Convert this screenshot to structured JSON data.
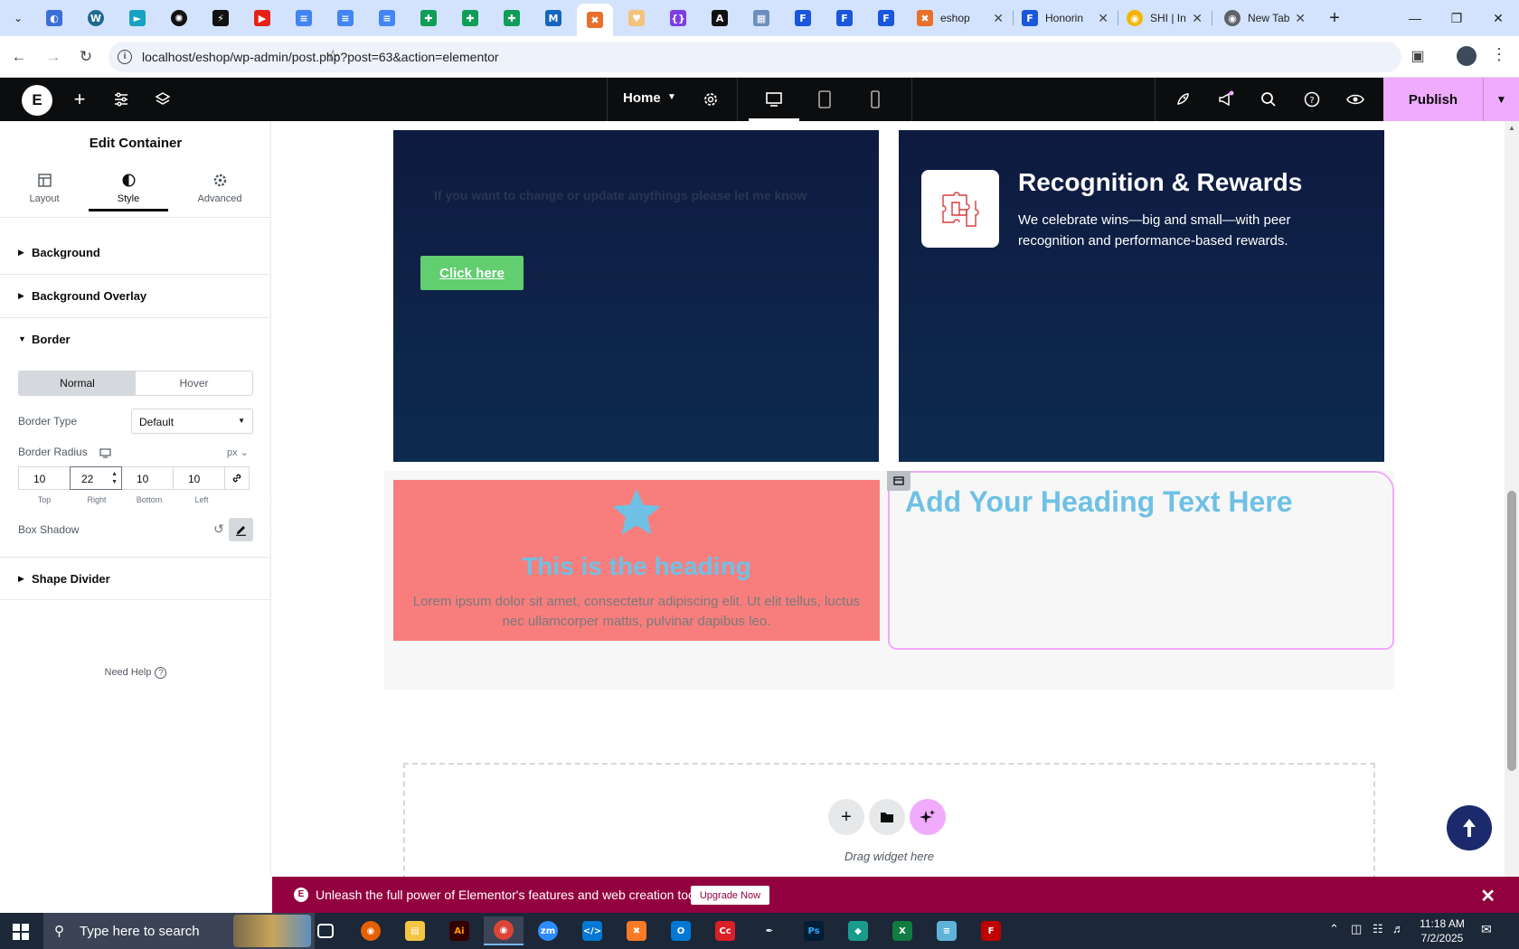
{
  "browser": {
    "tabs": [
      {
        "title": "eshop"
      },
      {
        "title": "Honorin"
      },
      {
        "title": "SHI | Inf"
      },
      {
        "title": "New Tab"
      }
    ],
    "url": "localhost/eshop/wp-admin/post.php?post=63&action=elementor"
  },
  "elementor": {
    "page_name": "Home",
    "publish_label": "Publish"
  },
  "panel": {
    "title": "Edit Container",
    "tabs": [
      {
        "label": "Layout"
      },
      {
        "label": "Style"
      },
      {
        "label": "Advanced"
      }
    ],
    "sections": {
      "background": "Background",
      "background_overlay": "Background Overlay",
      "border": "Border",
      "shape_divider": "Shape Divider"
    },
    "border": {
      "state_normal": "Normal",
      "state_hover": "Hover",
      "type_label": "Border Type",
      "type_value": "Default",
      "radius_label": "Border Radius",
      "unit": "px",
      "radius": {
        "top": "10",
        "right": "22",
        "bottom": "10",
        "left": "10"
      },
      "labels": {
        "top": "Top",
        "right": "Right",
        "bottom": "Bottom",
        "left": "Left"
      },
      "shadow_label": "Box Shadow"
    },
    "need_help": "Need Help"
  },
  "canvas": {
    "faded_text": "If you want to change or update anythings please let me know",
    "click_button": "Click here",
    "recognition_title": "Recognition & Rewards",
    "recognition_text": "We celebrate wins—big and small—with peer recognition and performance-based rewards.",
    "pink_heading": "This is the heading",
    "pink_text": "Lorem ipsum dolor sit amet, consectetur adipiscing elit. Ut elit tellus, luctus nec ullamcorper mattis, pulvinar dapibus leo.",
    "selected_heading": "Add Your Heading Text Here",
    "drag_text": "Drag widget here"
  },
  "promo": {
    "message": "Unleash the full power of Elementor's features and web creation tools.",
    "button": "Upgrade Now"
  },
  "taskbar": {
    "search_placeholder": "Type here to search",
    "time": "11:18 AM",
    "date": "7/2/2025"
  },
  "colors": {
    "elementor_accent": "#f0abfc",
    "navy_box": "#0e1a40",
    "pink_card": "#f87e7e",
    "heading_blue": "#6ec1e4",
    "button_green": "#61ce70",
    "promo_bg": "#93003f"
  }
}
